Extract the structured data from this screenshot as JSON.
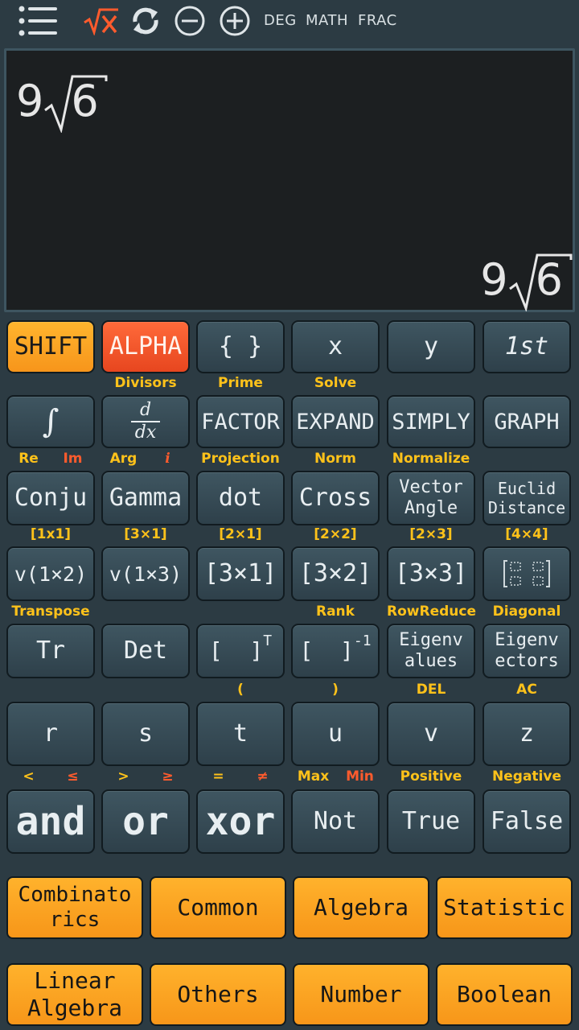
{
  "toolbar": {
    "icons": [
      "menu-icon",
      "sqrt-x-icon",
      "refresh-icon",
      "minus-circle-icon",
      "plus-circle-icon"
    ],
    "angle_mode": "DEG",
    "input_mode": "MATH",
    "output_mode": "FRAC",
    "accent": "#ff5b2d"
  },
  "display": {
    "expression": {
      "coefficient": "9",
      "radicand": "6"
    },
    "result": {
      "coefficient": "9",
      "radicand": "6"
    }
  },
  "keys": {
    "row1": [
      "SHIFT",
      "ALPHA",
      "{ }",
      "x",
      "y",
      "1st"
    ],
    "row2": [
      "∫",
      "d",
      "dx",
      "FACTOR",
      "EXPAND",
      "SIMPLY",
      "GRAPH"
    ],
    "row3": [
      "Conju",
      "Gamma",
      "dot",
      "Cross",
      "Vector",
      "Angle",
      "Euclid",
      "Distance"
    ],
    "row4": [
      "v(1×2)",
      "v(1×3)",
      "[3×1]",
      "[3×2]",
      "[3×3]"
    ],
    "row5": [
      "Tr",
      "Det",
      "[  ]",
      "T",
      "[  ]",
      "-1",
      "Eigenv",
      "alues",
      "Eigenv",
      "ectors"
    ],
    "row6": [
      "r",
      "s",
      "t",
      "u",
      "v",
      "z"
    ],
    "row7": [
      "and",
      "or",
      "xor",
      "Not",
      "True",
      "False"
    ]
  },
  "labels": {
    "row2": [
      "Divisors",
      "Prime",
      "Solve"
    ],
    "row3": [
      "Re",
      "Im",
      "Arg",
      "i",
      "Projection",
      "Norm",
      "Normalize"
    ],
    "row4": [
      "[1x1]",
      "[3×1]",
      "[2×1]",
      "[2×2]",
      "[2×3]",
      "[4×4]"
    ],
    "row5": [
      "Transpose",
      "Rank",
      "RowReduce",
      "Diagonal"
    ],
    "row6": [
      "(",
      ")",
      "DEL",
      "AC"
    ],
    "row7": [
      "<",
      "≤",
      ">",
      "≥",
      "=",
      "≠",
      "Max",
      "Min",
      "Positive",
      "Negative"
    ]
  },
  "categories": [
    [
      "Combinato",
      "rics"
    ],
    [
      "Common"
    ],
    [
      "Algebra"
    ],
    [
      "Statistic"
    ],
    [
      "Linear",
      "Algebra"
    ],
    [
      "Others"
    ],
    [
      "Number"
    ],
    [
      "Boolean"
    ]
  ]
}
